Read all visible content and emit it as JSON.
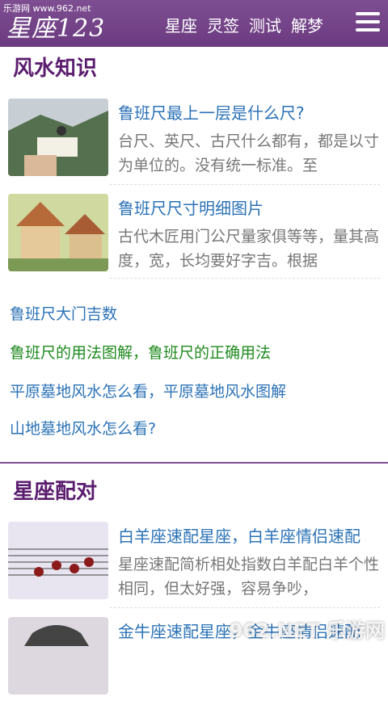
{
  "watermark_top": "乐游网 www.962.net",
  "header": {
    "logo": "星座123",
    "nav": [
      "星座",
      "灵签",
      "测试",
      "解梦"
    ]
  },
  "section1": {
    "title": "风水知识",
    "articles": [
      {
        "title": "鲁班尺最上一层是什么尺?",
        "desc": "台尺、英尺、古尺什么都有，都是以寸为单位的。没有统一标准。至"
      },
      {
        "title": "鲁班尺尺寸明细图片",
        "desc": "古代木匠用门公尺量家俱等等，量其高度，宽，长均要好字吉。根据"
      }
    ],
    "links": [
      {
        "text": "鲁班尺大门吉数"
      },
      {
        "text": "鲁班尺的用法图解，鲁班尺的正确用法"
      },
      {
        "text": "平原墓地风水怎么看，平原墓地风水图解"
      },
      {
        "text": "山地墓地风水怎么看?"
      }
    ]
  },
  "section2": {
    "title": "星座配对",
    "articles": [
      {
        "title": "白羊座速配星座，白羊座情侣速配",
        "desc": "星座速配简析相处指数白羊配白羊个性相同，但太好强，容易争吵，"
      },
      {
        "title": "金牛座速配星座，金牛座情侣速配",
        "desc": ""
      }
    ]
  },
  "watermark_br": "962.NET 乐游网"
}
